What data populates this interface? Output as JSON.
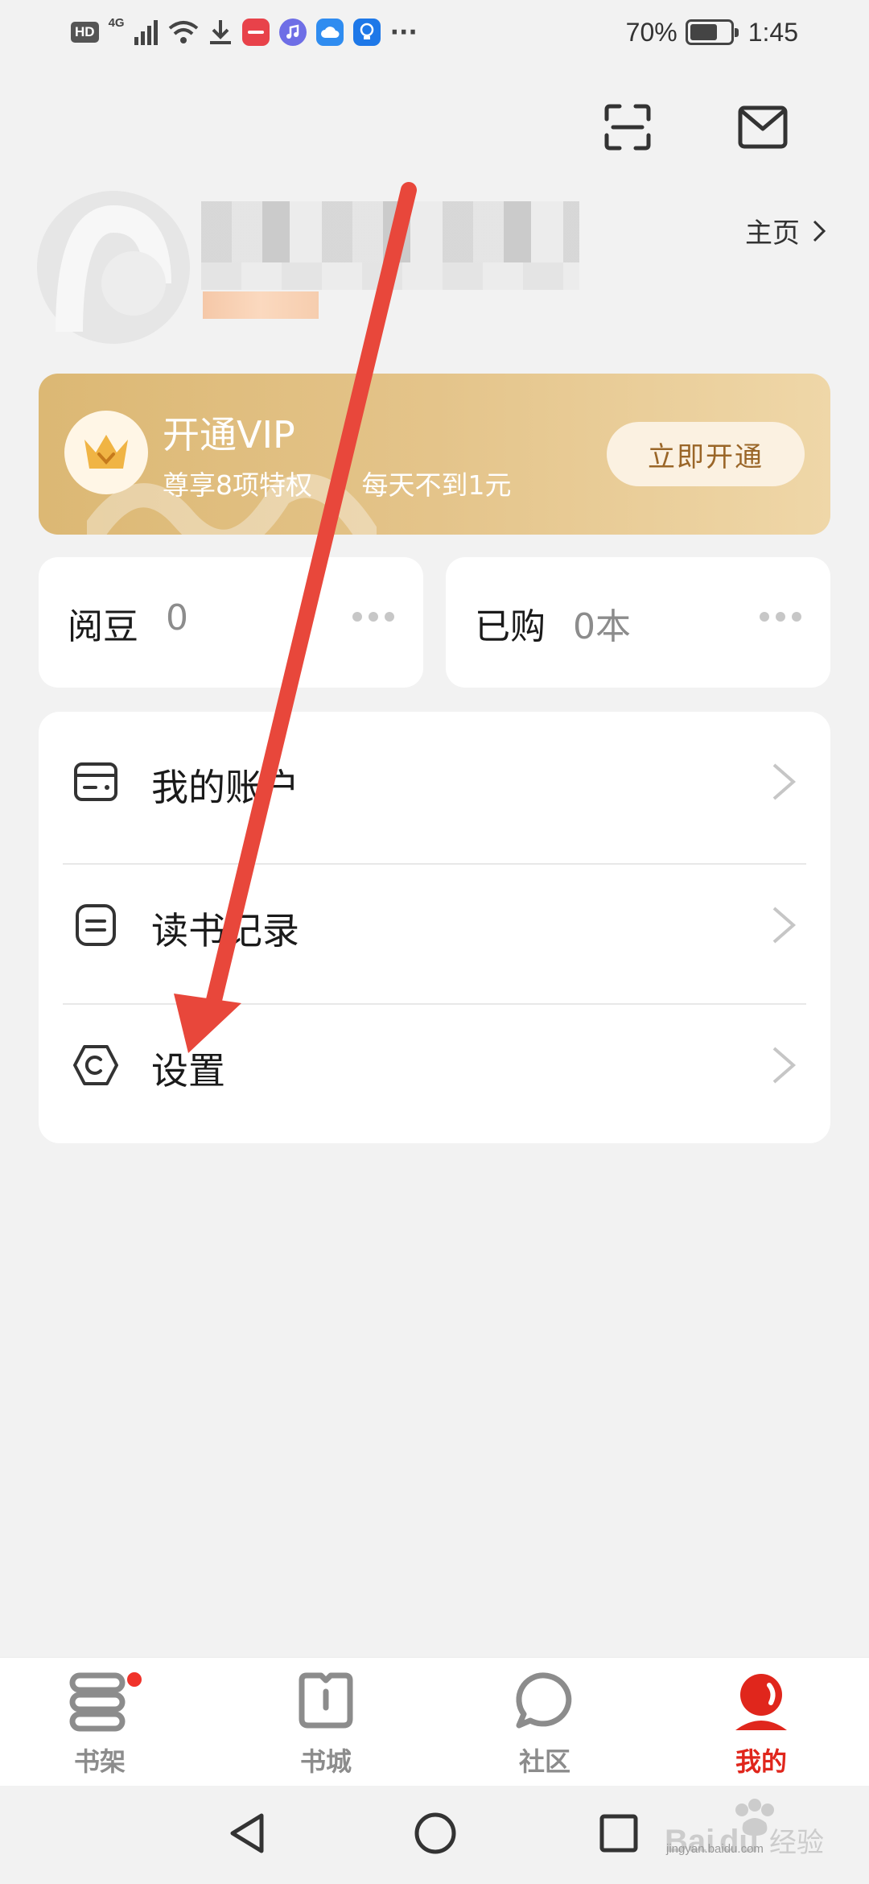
{
  "status_bar": {
    "hd": "HD",
    "network": "4G",
    "battery_text": "70%",
    "battery_level": 0.7,
    "time": "1:45",
    "more": "···"
  },
  "profile": {
    "homepage_label": "主页"
  },
  "vip": {
    "title": "开通VIP",
    "subtitle": "尊享8项特权   每天不到1元",
    "button": "立即开通"
  },
  "stats": [
    {
      "label": "阅豆",
      "value": "0"
    },
    {
      "label": "已购",
      "value": "0本"
    }
  ],
  "menu": [
    {
      "label": "我的账户",
      "icon": "wallet-icon"
    },
    {
      "label": "读书记录",
      "icon": "reading-record-icon"
    },
    {
      "label": "设置",
      "icon": "settings-hexagon-icon"
    }
  ],
  "tabs": [
    {
      "label": "书架",
      "icon": "bookshelf-icon",
      "active": false,
      "badge": true
    },
    {
      "label": "书城",
      "icon": "bookstore-icon",
      "active": false,
      "badge": false
    },
    {
      "label": "社区",
      "icon": "community-icon",
      "active": false,
      "badge": false
    },
    {
      "label": "我的",
      "icon": "profile-icon",
      "active": true,
      "badge": false
    }
  ],
  "colors": {
    "accent": "#e0261c",
    "vip_gold": "#dcb874",
    "background": "#f2f2f2",
    "arrow": "#e8473b"
  },
  "watermark": {
    "url_text": "jingyan.baidu.com"
  }
}
